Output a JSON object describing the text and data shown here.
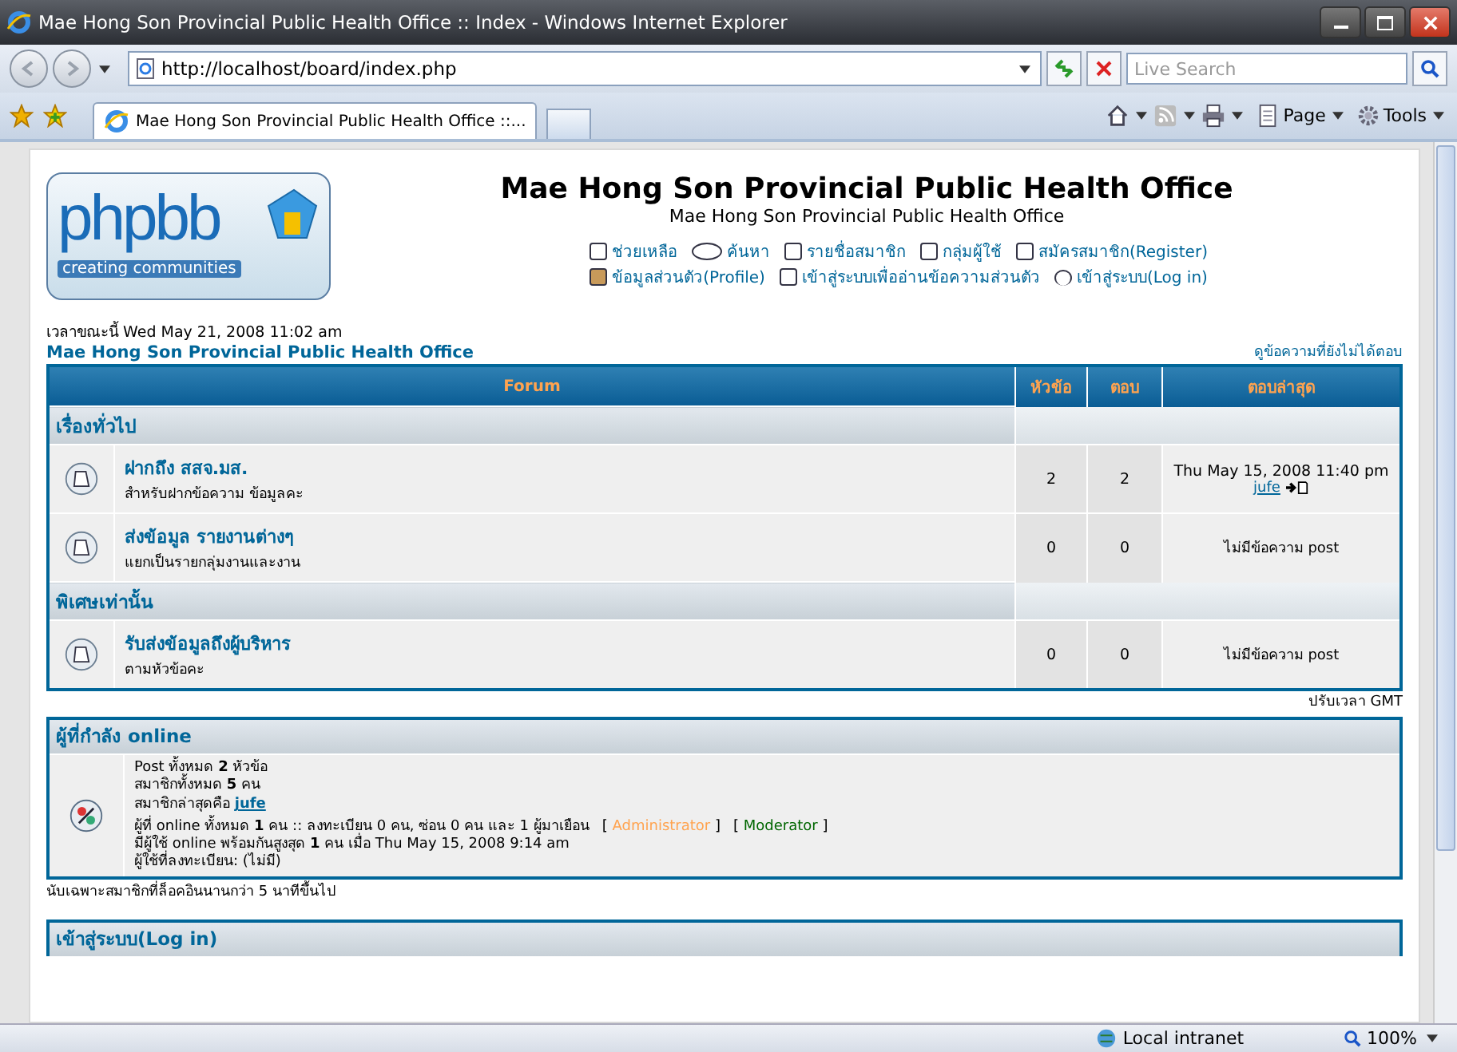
{
  "window": {
    "title": "Mae Hong Son Provincial Public Health Office :: Index - Windows Internet Explorer"
  },
  "address_bar": {
    "url": "http://localhost/board/index.php",
    "search_placeholder": "Live Search"
  },
  "tabs": [
    {
      "label": "Mae Hong Son Provincial Public Health Office ::...",
      "selected": true
    }
  ],
  "command_bar": [
    {
      "label": "Page",
      "kind": "page"
    },
    {
      "label": "Tools",
      "kind": "tools"
    }
  ],
  "page": {
    "logo": {
      "wordmark": "phpbb",
      "tagline": "creating communities"
    },
    "title": "Mae Hong Son Provincial Public Health Office",
    "subtitle": "Mae Hong Son Provincial Public Health Office",
    "nav": [
      {
        "label": "ช่วยเหลือ",
        "kind": "help"
      },
      {
        "label": "ค้นหา",
        "kind": "search"
      },
      {
        "label": "รายชื่อสมาชิก",
        "kind": "list"
      },
      {
        "label": "กลุ่มผู้ใช้",
        "kind": "list"
      },
      {
        "label": "สมัครสมาชิก(Register)",
        "kind": "check"
      },
      {
        "label": "ข้อมูลส่วนตัว(Profile)",
        "kind": "profile"
      },
      {
        "label": "เข้าสู่ระบบเพื่ออ่านข้อความส่วนตัว",
        "kind": "message"
      },
      {
        "label": "เข้าสู่ระบบ(Log in)",
        "kind": "login"
      }
    ],
    "current_time": "เวลาขณะนี้ Wed May 21, 2008 11:02 am",
    "forum_index_link": "Mae Hong Son Provincial Public Health Office",
    "unanswered_link": "ดูข้อความที่ยังไม่ได้ตอบ",
    "table": {
      "columns": [
        "Forum",
        "หัวข้อ",
        "ตอบ",
        "ตอบล่าสุด"
      ],
      "categories": [
        {
          "name": "เรื่องทั่วไป",
          "forums": [
            {
              "name": "ฝากถึง สสจ.มส.",
              "description": "สำหรับฝากข้อความ ข้อมูลคะ",
              "topics": "2",
              "posts": "2",
              "last_post": {
                "kind": "post",
                "date": "Thu May 15, 2008 11:40 pm",
                "user": "jufe"
              }
            },
            {
              "name": "ส่งข้อมูล รายงานต่างๆ",
              "description": "แยกเป็นรายกลุ่มงานและงาน",
              "topics": "0",
              "posts": "0",
              "last_post": {
                "kind": "none",
                "text": "ไม่มีข้อความ post"
              }
            }
          ]
        },
        {
          "name": "พิเศษเท่านั้น",
          "forums": [
            {
              "name": "รับส่งข้อมูลถึงผู้บริหาร",
              "description": "ตามหัวข้อคะ",
              "topics": "0",
              "posts": "0",
              "last_post": {
                "kind": "none",
                "text": "ไม่มีข้อความ post"
              }
            }
          ]
        }
      ]
    },
    "timezone": "ปรับเวลา GMT",
    "online": {
      "title": "ผู้ที่กำลัง online",
      "stats": [
        "Post ทั้งหมด **2** หัวข้อ",
        "สมาชิกทั้งหมด **5** คน"
      ],
      "newest_label": "สมาชิกล่าสุดคือ",
      "newest_user": "jufe",
      "users_online": "ผู้ที่ online ทั้งหมด **1** คน :: ลงทะเบียน 0 คน, ซ่อน 0 คน และ 1 ผู้มาเยือน",
      "legend": [
        {
          "open": "[",
          "label": "Administrator",
          "close": "]",
          "color": "#ffa34f"
        },
        {
          "open": "[",
          "label": "Moderator",
          "close": "]",
          "color": "#006600"
        }
      ],
      "record": "มีผู้ใช้ online พร้อมกันสูงสุด **1** คน เมื่อ Thu May 15, 2008 9:14 am",
      "registered": "ผู้ใช้ที่ลงทะเบียน: (ไม่มี)"
    },
    "note": "นับเฉพาะสมาชิกที่ล็อคอินนานกว่า 5 นาทีขึ้นไป",
    "login_box": {
      "title": "เข้าสู่ระบบ(Log in)"
    }
  },
  "status_bar": {
    "zone": "Local intranet",
    "zoom": "100%"
  }
}
